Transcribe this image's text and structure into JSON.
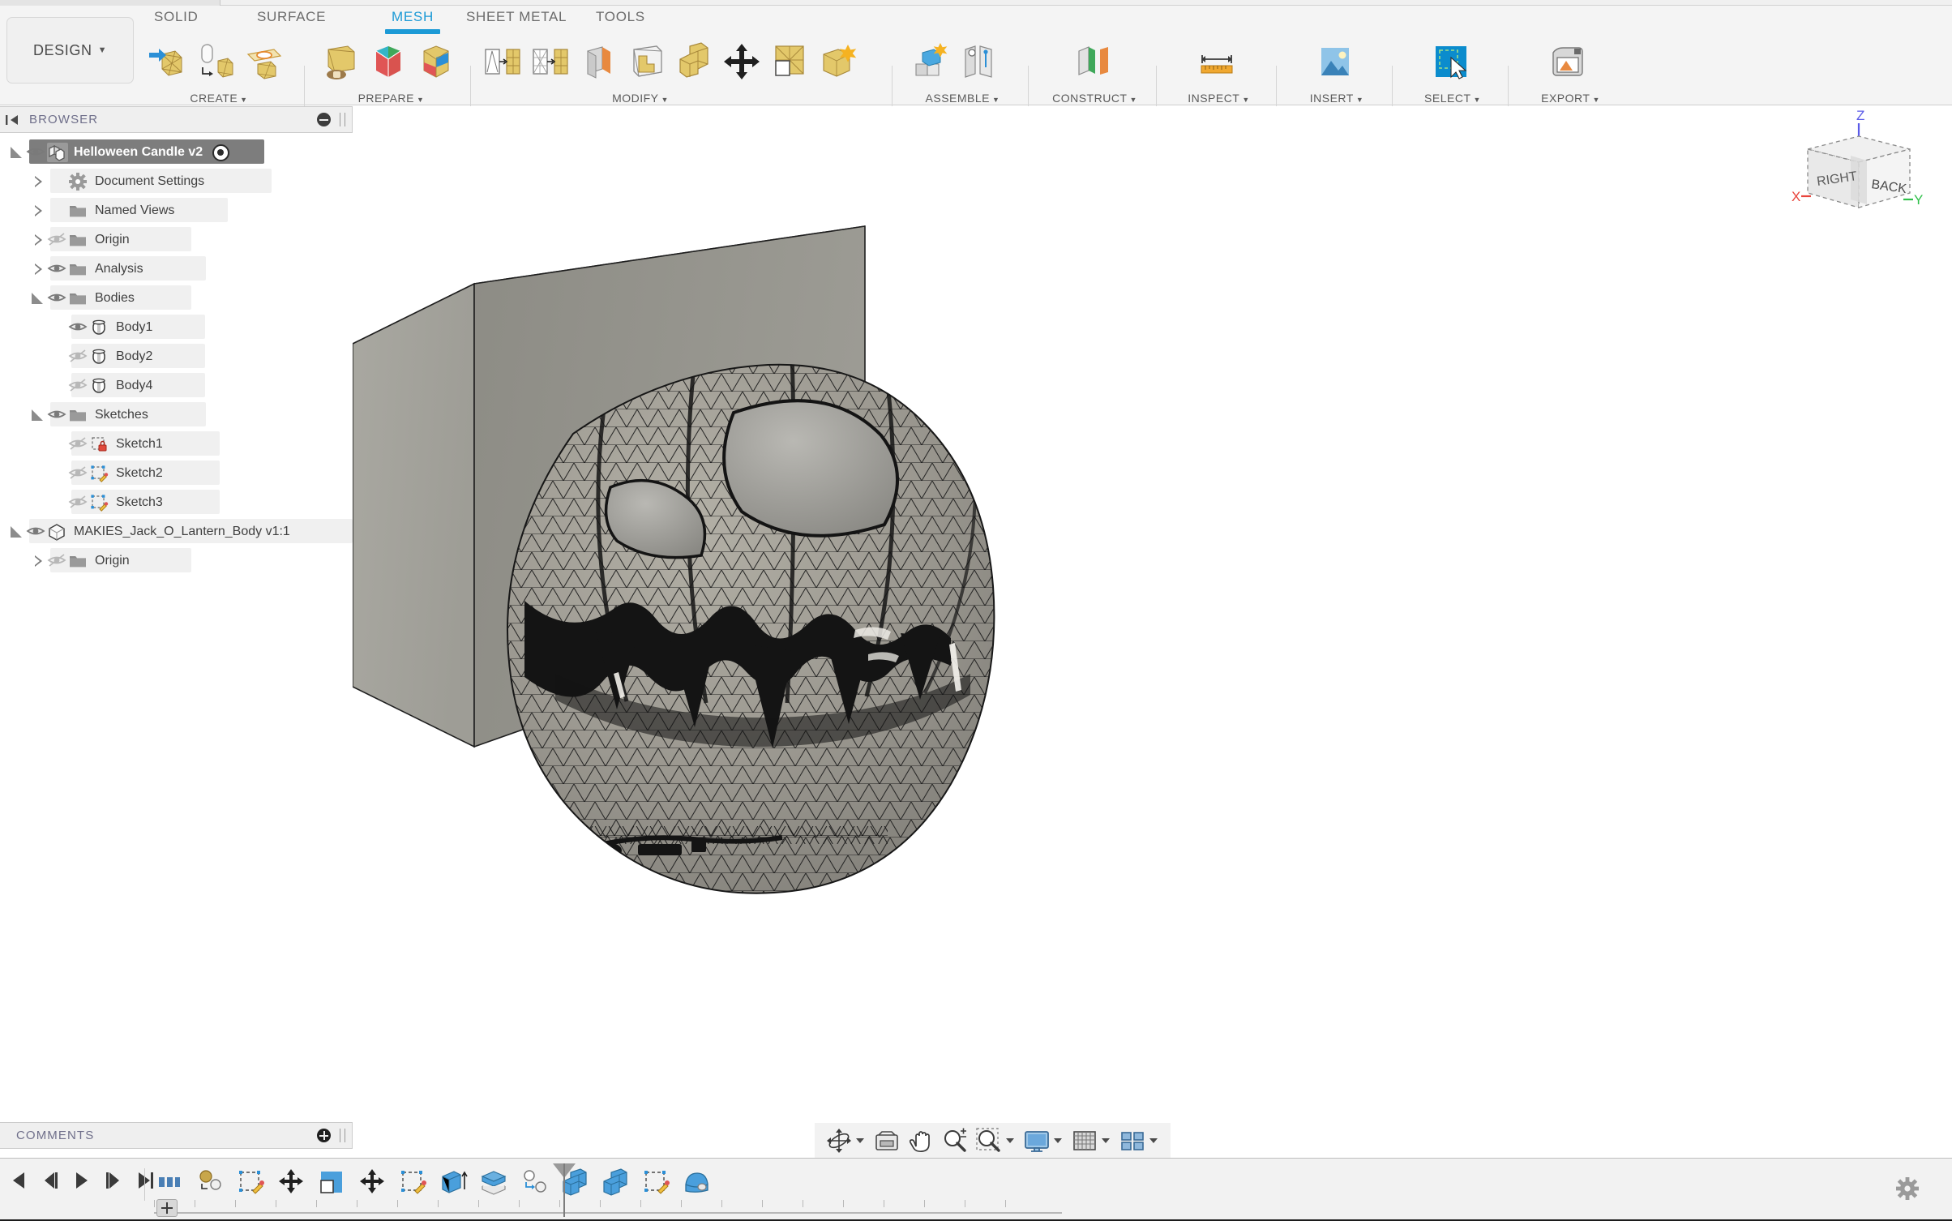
{
  "app": {
    "workspace_label": "DESIGN",
    "active_ribbon_tab": "MESH"
  },
  "ribbon": {
    "tabs": [
      {
        "label": "SOLID",
        "active": false
      },
      {
        "label": "SURFACE",
        "active": false
      },
      {
        "label": "MESH",
        "active": true
      },
      {
        "label": "SHEET METAL",
        "active": false
      },
      {
        "label": "TOOLS",
        "active": false
      }
    ],
    "panels": [
      {
        "name": "create",
        "label": "CREATE",
        "dropdown": true
      },
      {
        "name": "prepare",
        "label": "PREPARE",
        "dropdown": true
      },
      {
        "name": "modify",
        "label": "MODIFY",
        "dropdown": true
      },
      {
        "name": "assemble",
        "label": "ASSEMBLE",
        "dropdown": true
      },
      {
        "name": "construct",
        "label": "CONSTRUCT",
        "dropdown": true
      },
      {
        "name": "inspect",
        "label": "INSPECT",
        "dropdown": true
      },
      {
        "name": "insert",
        "label": "INSERT",
        "dropdown": true
      },
      {
        "name": "select",
        "label": "SELECT",
        "dropdown": true
      },
      {
        "name": "export",
        "label": "EXPORT",
        "dropdown": true
      }
    ]
  },
  "browser": {
    "title": "BROWSER",
    "collapse_icon": "collapse-left-icon",
    "minimize_icon": "minus-icon",
    "tree": [
      {
        "label": "Helloween Candle v2",
        "depth": 0,
        "arrow": "open",
        "eye": "visible",
        "icon": "component-icon",
        "selected": true,
        "target": true
      },
      {
        "label": "Document Settings",
        "depth": 1,
        "arrow": "closed",
        "eye": "none",
        "icon": "gear-icon",
        "selected": false,
        "target": false
      },
      {
        "label": "Named Views",
        "depth": 1,
        "arrow": "closed",
        "eye": "none",
        "icon": "folder-icon",
        "selected": false,
        "target": false
      },
      {
        "label": "Origin",
        "depth": 1,
        "arrow": "closed",
        "eye": "hidden",
        "icon": "folder-icon",
        "selected": false,
        "target": false
      },
      {
        "label": "Analysis",
        "depth": 1,
        "arrow": "closed",
        "eye": "visible",
        "icon": "folder-icon",
        "selected": false,
        "target": false
      },
      {
        "label": "Bodies",
        "depth": 1,
        "arrow": "open",
        "eye": "visible",
        "icon": "folder-icon",
        "selected": false,
        "target": false
      },
      {
        "label": "Body1",
        "depth": 2,
        "arrow": "none",
        "eye": "visible",
        "icon": "body-icon",
        "selected": false,
        "target": false
      },
      {
        "label": "Body2",
        "depth": 2,
        "arrow": "none",
        "eye": "hidden",
        "icon": "body-icon",
        "selected": false,
        "target": false
      },
      {
        "label": "Body4",
        "depth": 2,
        "arrow": "none",
        "eye": "hidden",
        "icon": "body-icon",
        "selected": false,
        "target": false
      },
      {
        "label": "Sketches",
        "depth": 1,
        "arrow": "open",
        "eye": "visible",
        "icon": "folder-icon",
        "selected": false,
        "target": false
      },
      {
        "label": "Sketch1",
        "depth": 2,
        "arrow": "none",
        "eye": "hidden",
        "icon": "sketch-locked-icon",
        "selected": false,
        "target": false
      },
      {
        "label": "Sketch2",
        "depth": 2,
        "arrow": "none",
        "eye": "hidden",
        "icon": "sketch-icon",
        "selected": false,
        "target": false
      },
      {
        "label": "Sketch3",
        "depth": 2,
        "arrow": "none",
        "eye": "hidden",
        "icon": "sketch-icon",
        "selected": false,
        "target": false
      },
      {
        "label": "MAKIES_Jack_O_Lantern_Body v1:1",
        "depth": 0,
        "arrow": "open",
        "eye": "visible",
        "icon": "mesh-body-icon",
        "selected": false,
        "target": false
      },
      {
        "label": "Origin",
        "depth": 1,
        "arrow": "closed",
        "eye": "hidden",
        "icon": "folder-icon",
        "selected": false,
        "target": false
      }
    ]
  },
  "viewcube": {
    "face_right_label": "RIGHT",
    "face_back_label": "BACK",
    "axis_x_label": "X",
    "axis_y_label": "Y",
    "axis_z_label": "Z",
    "axis_x_color": "#e8453c",
    "axis_y_color": "#2fc04a",
    "axis_z_color": "#5a5ae8"
  },
  "viewport": {
    "background": "#ffffff",
    "box_top_color": "#c2c0b9",
    "box_left_color": "#a5a49d",
    "box_front_color": "#8e8d86",
    "mesh_edge_color": "#1a1a1a",
    "mesh_fill_color": "#9d9a90"
  },
  "comments": {
    "title": "COMMENTS",
    "add_icon": "plus-icon"
  },
  "navbar": {
    "items": [
      {
        "name": "orbit",
        "icon": "orbit-icon",
        "dropdown": true
      },
      {
        "name": "look-at",
        "icon": "look-at-icon",
        "dropdown": false
      },
      {
        "name": "pan",
        "icon": "pan-hand-icon",
        "dropdown": false
      },
      {
        "name": "zoom",
        "icon": "zoom-icon",
        "dropdown": false
      },
      {
        "name": "zoom-window",
        "icon": "zoom-window-icon",
        "dropdown": true
      },
      {
        "name": "display-settings",
        "icon": "display-settings-icon",
        "dropdown": true
      },
      {
        "name": "grid-snaps",
        "icon": "grid-icon",
        "dropdown": true
      },
      {
        "name": "viewports",
        "icon": "viewports-icon",
        "dropdown": true
      }
    ]
  },
  "timeline": {
    "playback": [
      {
        "name": "go-to-beginning",
        "icon": "skip-start-icon"
      },
      {
        "name": "step-back",
        "icon": "step-back-icon"
      },
      {
        "name": "play",
        "icon": "play-icon"
      },
      {
        "name": "step-forward",
        "icon": "step-forward-icon"
      },
      {
        "name": "go-to-end",
        "icon": "skip-end-icon"
      }
    ],
    "features": [
      {
        "name": "document-settings",
        "icon": "doc-settings-icon"
      },
      {
        "name": "insert-mesh",
        "icon": "insert-mesh-icon"
      },
      {
        "name": "sketch",
        "icon": "sketch-icon"
      },
      {
        "name": "move-copy",
        "icon": "move-icon"
      },
      {
        "name": "extrude",
        "icon": "extrude-icon"
      },
      {
        "name": "move-copy",
        "icon": "move-icon"
      },
      {
        "name": "sketch",
        "icon": "sketch-icon"
      },
      {
        "name": "extrude",
        "icon": "extrude-up-icon"
      },
      {
        "name": "split-body",
        "icon": "split-body-icon"
      },
      {
        "name": "align",
        "icon": "align-icon"
      },
      {
        "name": "combine",
        "icon": "combine-icon"
      },
      {
        "name": "combine",
        "icon": "combine-icon"
      },
      {
        "name": "sketch",
        "icon": "sketch-icon"
      },
      {
        "name": "revolve",
        "icon": "revolve-icon"
      }
    ],
    "marker_position": "end",
    "settings_icon": "gear-icon"
  }
}
